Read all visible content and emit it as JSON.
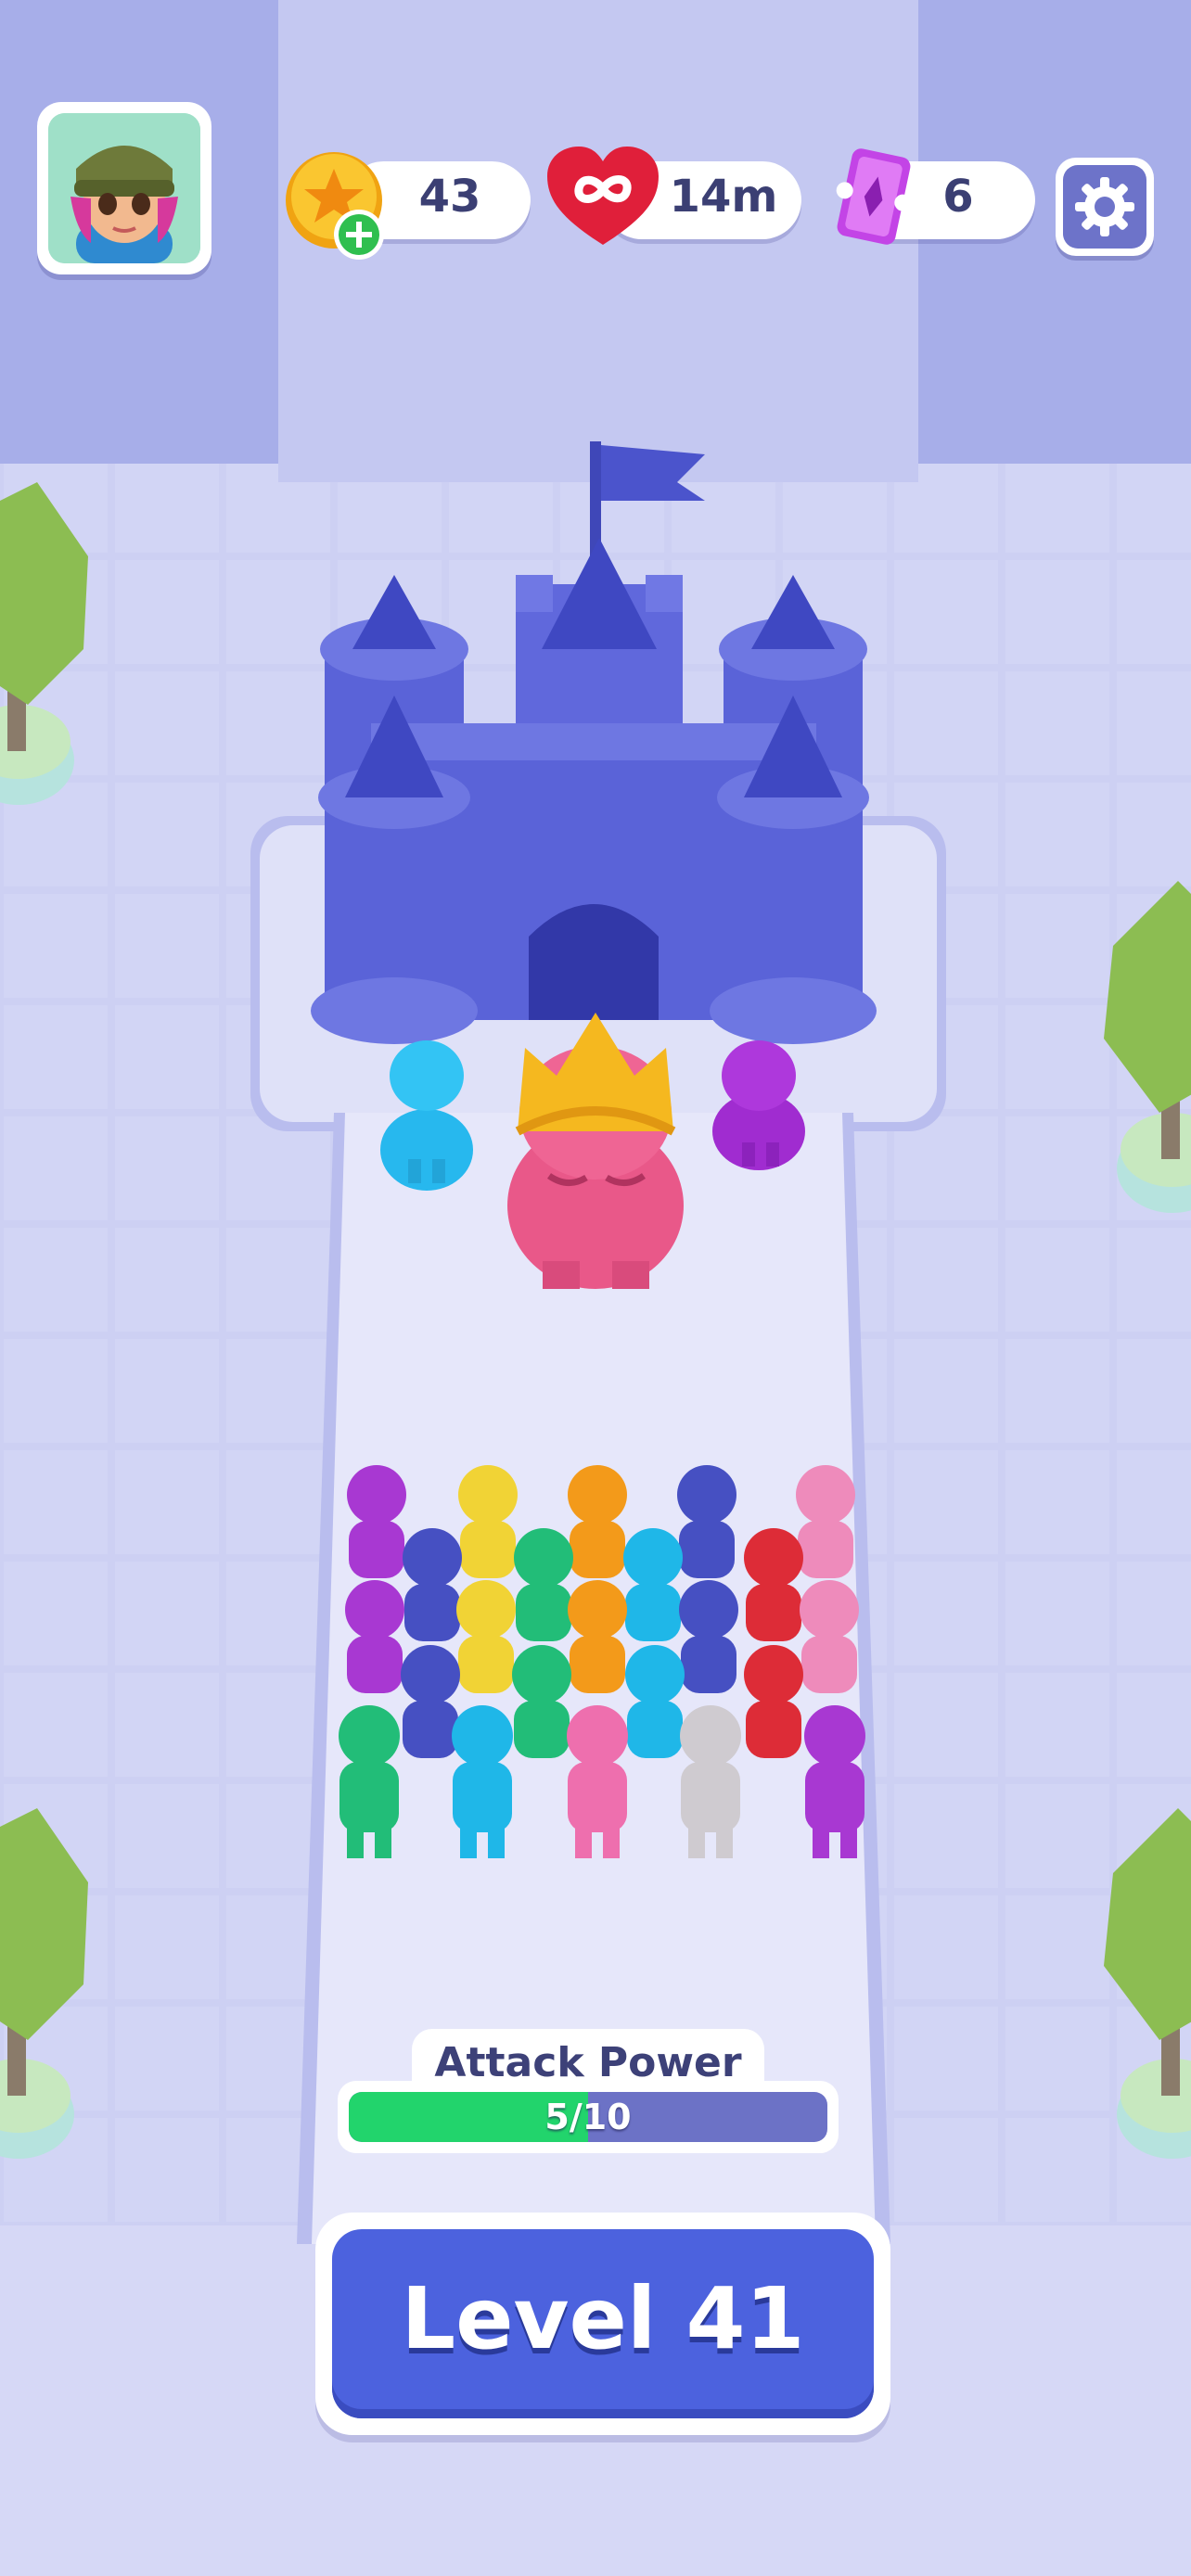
{
  "hud": {
    "avatar_icon": "player-avatar-icon",
    "coins": {
      "icon": "gold-coin-icon",
      "add_icon": "plus-icon",
      "value": "43"
    },
    "lives": {
      "icon": "infinity-heart-icon",
      "value": "14m"
    },
    "tickets": {
      "icon": "ticket-icon",
      "value": "6"
    },
    "settings_icon": "gear-icon"
  },
  "attack_power": {
    "label": "Attack Power",
    "value_text": "5/10",
    "current": 5,
    "max": 10
  },
  "level_button": {
    "label": "Level 41"
  },
  "colors": {
    "castle": "#5a63d8",
    "boss": "#ec5a8c",
    "crown": "#f5b81f",
    "progress_fill": "#22d46c",
    "progress_track": "#6c72c6",
    "level_button": "#4c62de"
  }
}
